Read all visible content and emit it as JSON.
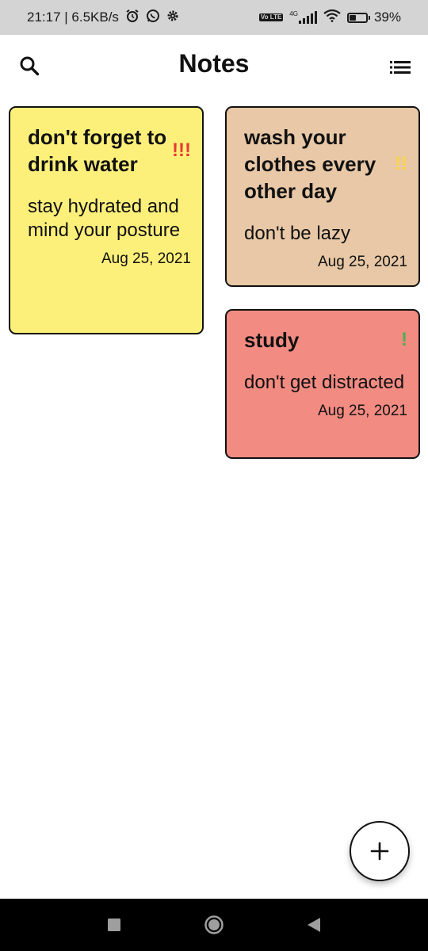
{
  "status_bar": {
    "time_speed": "21:17 | 6.5KB/s",
    "alarm_icon": "alarm-icon",
    "whatsapp_icon": "whatsapp-icon",
    "settings_icon": "gear-icon",
    "volte_label": "Vo LTE",
    "network_label": "4G",
    "battery_percent": "39%",
    "battery_level": 0.39
  },
  "app_bar": {
    "title": "Notes",
    "search_icon": "search-icon",
    "menu_icon": "list-view-icon"
  },
  "notes": [
    {
      "title": "don't forget to drink water",
      "body": "stay hydrated and mind your posture",
      "date": "Aug 25, 2021",
      "priority": "!!!",
      "priority_color": "#e53935",
      "bg_color": "#fdf07a"
    },
    {
      "title": "wash your clothes every other day",
      "body": "don't be lazy",
      "date": "Aug 25, 2021",
      "priority": "!!",
      "priority_color": "#f9d648",
      "bg_color": "#e8c8a6"
    },
    {
      "title": "study",
      "body": "don't get distracted",
      "date": "Aug 25, 2021",
      "priority": "!",
      "priority_color": "#4caf50",
      "bg_color": "#f28b82"
    }
  ],
  "fab": {
    "icon": "plus-icon"
  },
  "nav_bar": {
    "recents_icon": "recents-square-icon",
    "home_icon": "home-circle-icon",
    "back_icon": "back-triangle-icon"
  }
}
